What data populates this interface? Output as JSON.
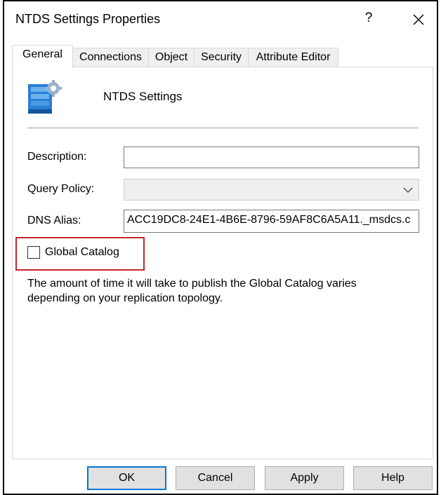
{
  "window": {
    "title": "NTDS Settings Properties",
    "help_glyph": "?"
  },
  "tabs": [
    {
      "label": "General",
      "active": true
    },
    {
      "label": "Connections",
      "active": false
    },
    {
      "label": "Object",
      "active": false
    },
    {
      "label": "Security",
      "active": false
    },
    {
      "label": "Attribute Editor",
      "active": false
    }
  ],
  "general": {
    "object_name": "NTDS Settings",
    "description": {
      "label": "Description:",
      "value": ""
    },
    "query_policy": {
      "label": "Query Policy:",
      "value": "",
      "disabled": true
    },
    "dns_alias": {
      "label": "DNS Alias:",
      "value": "ACC19DC8-24E1-4B6E-8796-59AF8C6A5A11._msdcs.c"
    },
    "global_catalog": {
      "label": "Global Catalog",
      "checked": false,
      "highlight_color": "#c4262e"
    },
    "note": "The amount of time it will take to publish the Global Catalog varies depending on your replication topology."
  },
  "buttons": {
    "ok": "OK",
    "cancel": "Cancel",
    "apply": "Apply",
    "help": "Help"
  },
  "colors": {
    "default_button_border": "#0078d7",
    "button_face": "#e1e1e1",
    "disabled_field": "#efefef"
  },
  "icons": {
    "object": "server-settings-icon",
    "close": "close-icon",
    "dropdown": "chevron-down-icon"
  }
}
